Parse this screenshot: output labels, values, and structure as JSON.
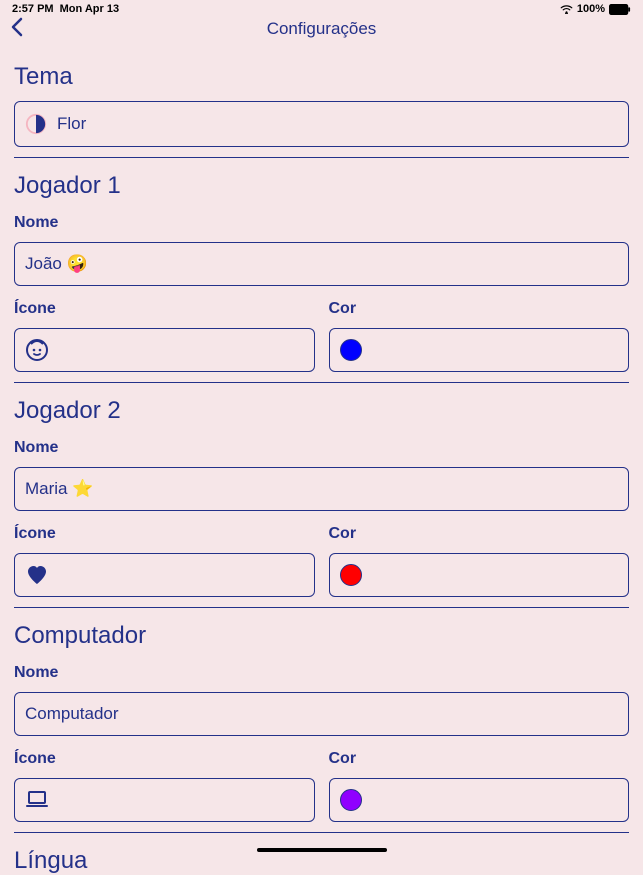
{
  "status": {
    "time": "2:57 PM",
    "date": "Mon Apr 13",
    "battery": "100%"
  },
  "nav": {
    "title": "Configurações"
  },
  "theme": {
    "section_title": "Tema",
    "value": "Flor"
  },
  "labels": {
    "nome": "Nome",
    "icone": "Ícone",
    "cor": "Cor"
  },
  "player1": {
    "section_title": "Jogador 1",
    "name": "João 🤪",
    "icon": "face-icon",
    "color": "#0000ff"
  },
  "player2": {
    "section_title": "Jogador 2",
    "name": "Maria ⭐",
    "icon": "heart-icon",
    "color": "#ff0000"
  },
  "computer": {
    "section_title": "Computador",
    "name": "Computador",
    "icon": "laptop-icon",
    "color": "#9000ff"
  },
  "language": {
    "section_title": "Língua"
  }
}
